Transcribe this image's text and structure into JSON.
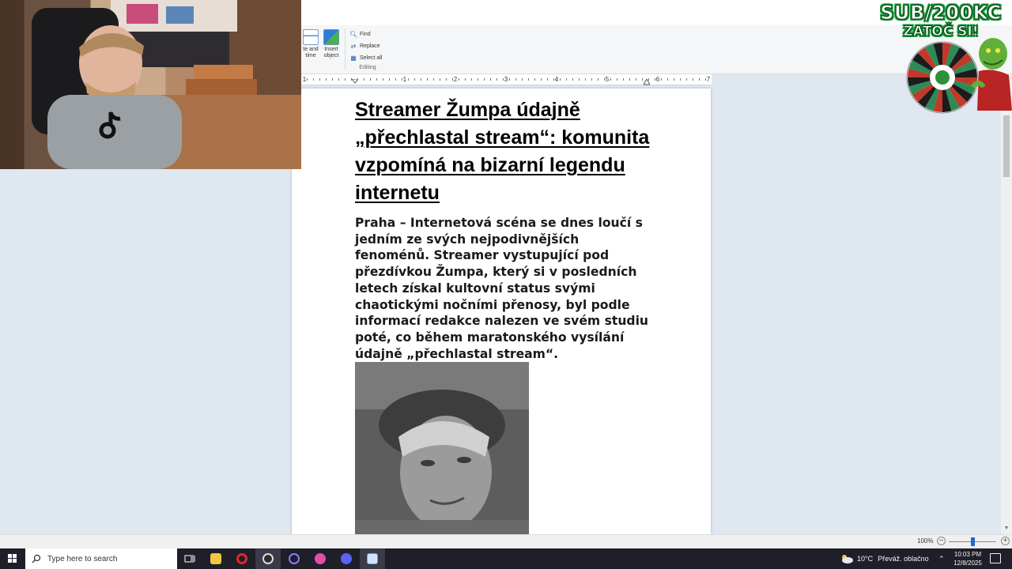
{
  "ribbon": {
    "date_time_label": "te and time",
    "insert_object_label": "Insert object",
    "editing_items": [
      {
        "label": "Find",
        "icon": "find-icon"
      },
      {
        "label": "Replace",
        "icon": "replace-icon"
      },
      {
        "label": "Select all",
        "icon": "select-all-icon"
      }
    ],
    "group_label": "Editing"
  },
  "ruler": {
    "numbers": [
      "1",
      "1",
      "2",
      "3",
      "4",
      "5",
      "6",
      "7"
    ]
  },
  "document": {
    "headline": "Streamer Žumpa údajně „přechlastal stream“: komunita vzpomíná na bizarní legendu internetu",
    "body": "Praha – Internetová scéna se dnes loučí s jedním ze svých nejpodivnějších fenoménů. Streamer vystupující pod přezdívkou Žumpa, který si v posledních letech získal kultovní status svými chaotickými nočními přenosy, byl podle informací redakce nalezen ve svém studiu poté, co během maratonského vysílání údajně „přechlastal stream“."
  },
  "statusbar": {
    "zoom": "100%",
    "zoom_level": 1.0
  },
  "taskbar": {
    "search_placeholder": "Type here to search",
    "weather_temp": "10°C",
    "weather_text": "Převáž. oblačno",
    "time": "10:03 PM",
    "date": "12/8/2025"
  },
  "overlay": {
    "line1": "SUB/200KC",
    "line2": "ZATOČ SI!"
  },
  "colors": {
    "accent": "#1d6ad0",
    "taskbar": "#1f1f2a",
    "overlay_green": "#14a13d",
    "background": "#dfe7f1"
  }
}
